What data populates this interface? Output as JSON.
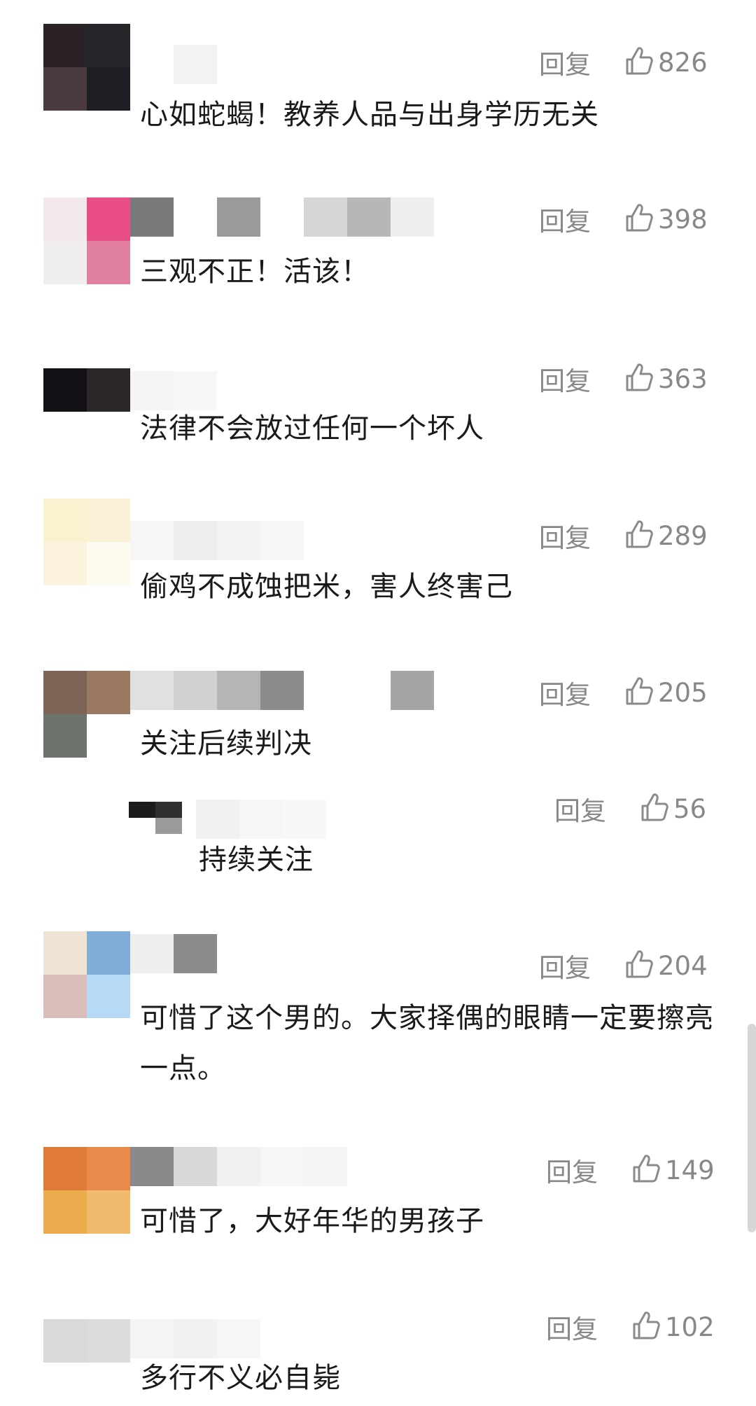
{
  "ui": {
    "reply_label": "回复",
    "accent_gray": "#888888"
  },
  "comments": [
    {
      "likes": "826",
      "text": "心如蛇蝎！教养人品与出身学历无关",
      "avatar_colors": [
        "#2b2227",
        "#24262a",
        "#4b3a40",
        "#1e1f24"
      ],
      "name_colors": [
        "#ffffff",
        "#f2f2f2",
        "#ffffff"
      ]
    },
    {
      "likes": "398",
      "text": "三观不正！活该！",
      "avatar_colors": [
        "#f3e9ea",
        "#e94e86",
        "#f1eef0",
        "#e07f9e"
      ],
      "name_colors": [
        "#7a7a7a",
        "#ffffff",
        "#9a9a9a",
        "#ffffff",
        "#d6d6d6",
        "#b7b7b7",
        "#efefef"
      ]
    },
    {
      "likes": "363",
      "text": "法律不会放过任何一个坏人",
      "avatar_colors": [
        "#121014",
        "#2b2629",
        "#ffffff",
        "#ffffff"
      ],
      "name_colors": [
        "#f5f5f5",
        "#f7f7f7",
        "#ffffff"
      ]
    },
    {
      "likes": "289",
      "text": "偷鸡不成蚀把米，害人终害己",
      "avatar_colors": [
        "#fbf0d0",
        "#fbf1d6",
        "#fbf3dd",
        "#fdfaf0"
      ],
      "name_colors": [
        "#f6f6f6",
        "#eeeeee",
        "#f2f2f2",
        "#f6f6f6"
      ]
    },
    {
      "likes": "205",
      "text": "关注后续判决",
      "avatar_colors": [
        "#7d6457",
        "#9a7a62",
        "#6b736b",
        "#ffffff"
      ],
      "name_colors": [
        "#e0e0e0",
        "#d0d0d0",
        "#b5b5b5",
        "#8c8c8c",
        "#ffffff",
        "#ffffff",
        "#a5a5a5"
      ]
    },
    {
      "likes": "56",
      "text": "持续关注",
      "avatar_colors": [
        "#1c1c1c",
        "#303030",
        "#ffffff",
        "#9a9a9a"
      ],
      "name_colors": [
        "#f1f1f1",
        "#f6f6f6",
        "#f8f8f8"
      ]
    },
    {
      "likes": "204",
      "text": "可惜了这个男的。大家择偶的眼睛一定要擦亮一点。",
      "avatar_colors": [
        "#f1e3d3",
        "#7faed8",
        "#d8bdb8",
        "#b6daf5"
      ],
      "name_colors": [
        "#eeeeee",
        "#8c8c8c"
      ]
    },
    {
      "likes": "149",
      "text": "可惜了，大好年华的男孩子",
      "avatar_colors": [
        "#e07a3a",
        "#e98a4a",
        "#ecac4e",
        "#f1ba6c"
      ],
      "name_colors": [
        "#8a8a8a",
        "#d8d8d8",
        "#f1f1f1",
        "#f6f6f6",
        "#f5f5f5"
      ]
    },
    {
      "likes": "102",
      "text": "多行不义必自毙",
      "avatar_colors": [
        "#d9d9d7",
        "#dcdcda",
        "#ffffff",
        "#ffffff"
      ],
      "name_colors": [
        "#f4f4f4",
        "#f1f1f1",
        "#f6f6f6"
      ]
    }
  ]
}
